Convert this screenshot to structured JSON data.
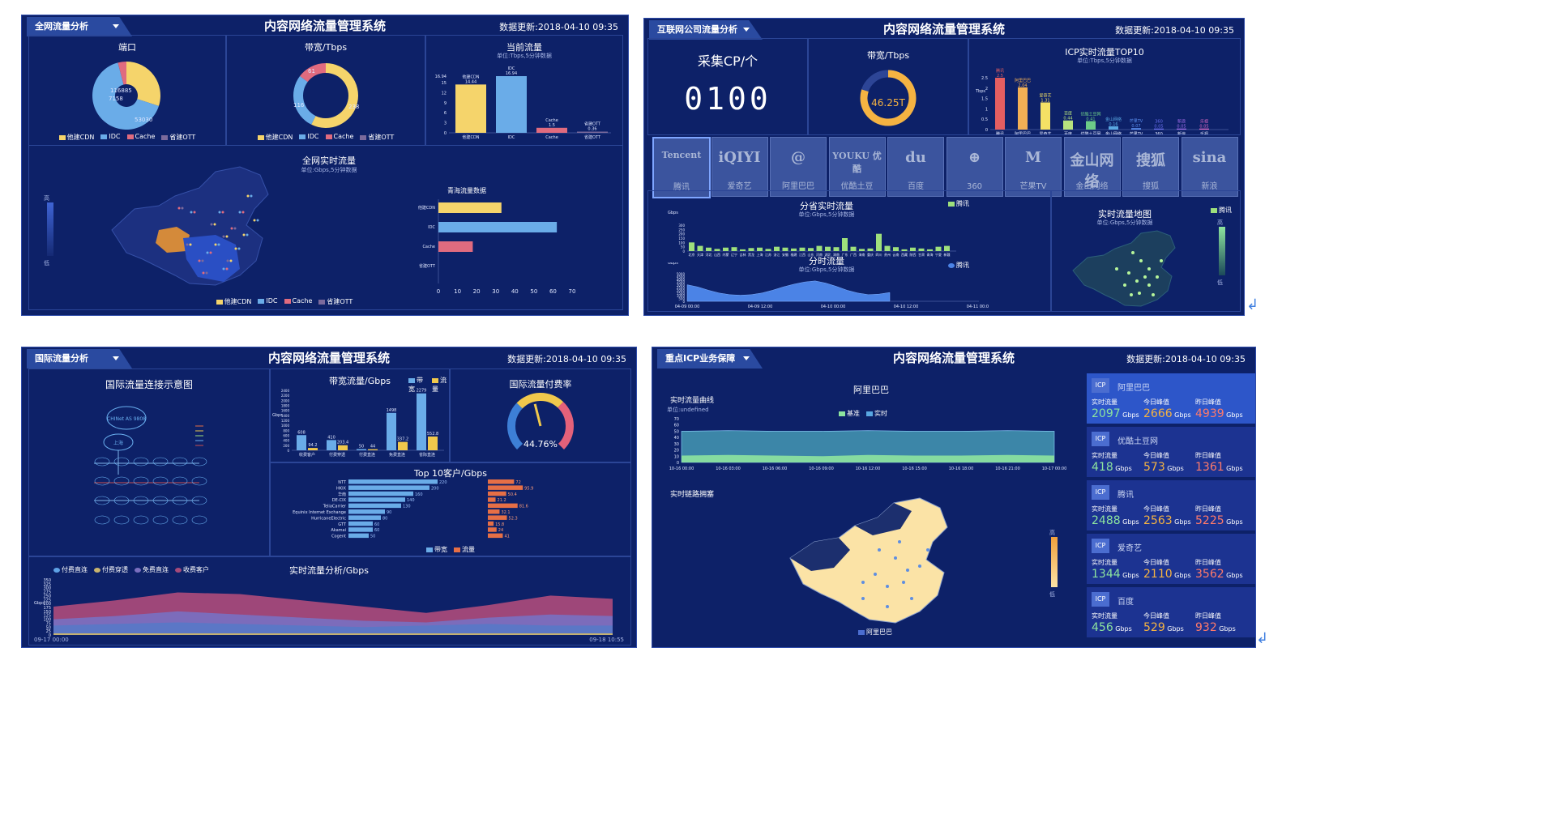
{
  "system_title": "内容网络流量管理系统",
  "update_time": "数据更新:2018-04-10 09:35",
  "panels": {
    "p1": {
      "tab": "全网流量分析",
      "port": {
        "title": "端口",
        "labels": [
          "116885",
          "7158",
          "53030"
        ]
      },
      "bandwidth": {
        "title": "带宽/Tbps",
        "labels": [
          "61",
          "116",
          "238"
        ]
      },
      "current": {
        "title": "当前流量",
        "subtitle": "单位:Tbps,5分钟数据"
      },
      "legend": [
        {
          "name": "他建CDN",
          "color": "#f5d46b"
        },
        {
          "name": "IDC",
          "color": "#6aace8"
        },
        {
          "name": "Cache",
          "color": "#e06b7f"
        },
        {
          "name": "省建OTT",
          "color": "#7b6a9c"
        }
      ],
      "map": {
        "title": "全网实时流量",
        "subtitle": "单位:Gbps,5分钟数据",
        "high": "高",
        "low": "低"
      },
      "province": {
        "title": "青海流量数据"
      }
    },
    "p2": {
      "tab": "互联网公司流量分析",
      "cp": {
        "title": "采集CP/个",
        "value": "0100"
      },
      "bw": {
        "title": "带宽/Tbps",
        "value": "46.25T"
      },
      "top10": {
        "title": "ICP实时流量TOP10",
        "subtitle": "单位:Tbps,5分钟数据"
      },
      "logos": [
        {
          "mark": "Tencent",
          "name": "腾讯"
        },
        {
          "mark": "iQIYI",
          "name": "爱奇艺"
        },
        {
          "mark": "@",
          "name": "阿里巴巴"
        },
        {
          "mark": "YOUKU 优酷",
          "name": "优酷土豆"
        },
        {
          "mark": "du",
          "name": "百度"
        },
        {
          "mark": "⊕",
          "name": "360"
        },
        {
          "mark": "M",
          "name": "芒果TV"
        },
        {
          "mark": "金山网络",
          "name": "金山网络"
        },
        {
          "mark": "搜狐",
          "name": "搜狐"
        },
        {
          "mark": "sina",
          "name": "新浪"
        }
      ],
      "province_rt": {
        "title": "分省实时流量",
        "subtitle": "单位:Gbps,5分钟数据",
        "unit": "Gbps",
        "legend": "腾讯"
      },
      "time_flow": {
        "title": "分时流量",
        "subtitle": "单位:Gbps,5分钟数据",
        "unit": "Gbps",
        "legend": "腾讯"
      },
      "map": {
        "title": "实时流量地图",
        "subtitle": "单位:Gbps,5分钟数据",
        "legend": "腾讯",
        "high": "高",
        "low": "低"
      }
    },
    "p3": {
      "tab": "国际流量分析",
      "connect": {
        "title": "国际流量连接示意图",
        "cloud1": "CHINet AS 9808",
        "cloud2": "上海"
      },
      "bw_flow": {
        "title": "带宽流量/Gbps",
        "legend": [
          "带宽",
          "流量"
        ]
      },
      "rate": {
        "title": "国际流量付费率",
        "value": "44.76%"
      },
      "top10": {
        "title": "Top 10客户/Gbps",
        "legend": [
          "带宽",
          "流量"
        ]
      },
      "rt": {
        "title": "实时流量分析/Gbps",
        "legend": [
          "付费直连",
          "付费穿透",
          "免费直连",
          "收费客户"
        ],
        "x_start": "09-17 00:00",
        "x_end": "09-18 10:55",
        "ylabel": "Gbps"
      }
    },
    "p4": {
      "tab": "重点ICP业务保障",
      "company": "阿里巴巴",
      "curve": {
        "title": "实时流量曲线",
        "subtitle": "单位:undefined",
        "legend": [
          "基准",
          "实时"
        ]
      },
      "link": {
        "title": "实时链路拥塞"
      },
      "map_legend": "阿里巴巴",
      "map_high": "高",
      "map_low": "低",
      "col_labels": [
        "实时流量",
        "今日峰值",
        "昨日峰值"
      ],
      "unit": "Gbps",
      "icps": [
        {
          "badge": "ICP",
          "name": "阿里巴巴",
          "v": [
            "2097",
            "2666",
            "4939"
          ]
        },
        {
          "badge": "ICP",
          "name": "优酷土豆网",
          "v": [
            "418",
            "573",
            "1361"
          ]
        },
        {
          "badge": "ICP",
          "name": "腾讯",
          "v": [
            "2488",
            "2563",
            "5225"
          ]
        },
        {
          "badge": "ICP",
          "name": "爱奇艺",
          "v": [
            "1344",
            "2110",
            "3562"
          ]
        },
        {
          "badge": "ICP",
          "name": "百度",
          "v": [
            "456",
            "529",
            "932"
          ]
        }
      ]
    }
  },
  "chart_data": [
    {
      "type": "pie",
      "title": "端口",
      "categories": [
        "他建CDN",
        "IDC",
        "Cache",
        "省建OTT"
      ],
      "values": [
        53030,
        116885,
        7158,
        0
      ]
    },
    {
      "type": "pie",
      "title": "带宽/Tbps",
      "categories": [
        "他建CDN",
        "IDC",
        "Cache",
        "省建OTT"
      ],
      "values": [
        238,
        116,
        61,
        0
      ]
    },
    {
      "type": "bar",
      "title": "当前流量",
      "categories": [
        "他建CDN",
        "IDC",
        "Cache",
        "省建OTT"
      ],
      "values": [
        14.44,
        16.94,
        1.5,
        0.36
      ],
      "yticks": [
        0,
        3,
        6,
        9,
        12,
        15,
        16.94
      ],
      "ylim": [
        0,
        16.94
      ]
    },
    {
      "type": "bar",
      "title": "青海流量数据",
      "categories": [
        "他建CDN",
        "IDC",
        "Cache",
        "省建OTT"
      ],
      "values": [
        33,
        62,
        18,
        0
      ],
      "xlim": [
        0,
        70
      ],
      "xticks": [
        0,
        10,
        20,
        30,
        40,
        50,
        60,
        70
      ]
    },
    {
      "type": "bar",
      "title": "ICP实时流量TOP10",
      "categories": [
        "腾讯",
        "阿里巴巴",
        "爱奇艺",
        "百度",
        "优酷土豆网",
        "金山网络",
        "芒果TV",
        "360",
        "新浪",
        "乐视"
      ],
      "values": [
        2.5,
        2.04,
        1.31,
        0.44,
        0.41,
        0.16,
        0.07,
        0.05,
        0.05,
        0.05
      ],
      "ylabel": "Tbps",
      "yticks": [
        0,
        0.5,
        1,
        1.5,
        2,
        2.5
      ],
      "ylim": [
        0,
        2.5
      ],
      "colors": [
        "#e45e61",
        "#f2b055",
        "#f5e165",
        "#b7e27e",
        "#6ccb88",
        "#59a7e2",
        "#5b8ff0",
        "#6a6ff0",
        "#a06ce8",
        "#e069c4"
      ]
    },
    {
      "type": "bar",
      "title": "分省实时流量",
      "categories": [
        "北京",
        "天津",
        "河北",
        "山西",
        "内蒙古",
        "辽宁",
        "吉林",
        "黑龙江",
        "上海",
        "江苏",
        "浙江",
        "安徽",
        "福建",
        "江西",
        "山东",
        "河南",
        "湖北",
        "湖南",
        "广东",
        "广西",
        "海南",
        "重庆",
        "四川",
        "贵州",
        "云南",
        "西藏",
        "陕西",
        "甘肃",
        "青海",
        "宁夏",
        "新疆"
      ],
      "values": [
        100,
        60,
        40,
        25,
        40,
        45,
        20,
        35,
        40,
        25,
        50,
        40,
        30,
        40,
        35,
        60,
        50,
        45,
        150,
        50,
        25,
        30,
        200,
        60,
        45,
        20,
        40,
        30,
        20,
        50,
        60
      ],
      "ylim": [
        0,
        300
      ],
      "yticks": [
        0,
        50,
        100,
        150,
        200,
        250,
        300
      ],
      "series_name": "腾讯"
    },
    {
      "type": "area",
      "title": "分时流量",
      "x": [
        "04-09 00:00",
        "04-09 12:00",
        "04-10 00:00",
        "04-10 12:00",
        "04-11 00:00"
      ],
      "yticks": [
        0,
        500,
        1000,
        1500,
        2000,
        2500,
        3000,
        3500,
        4000,
        4500,
        5000
      ],
      "ylim": [
        0,
        5000
      ],
      "values": [
        3000,
        2600,
        2000,
        1500,
        1200,
        1100,
        1200,
        1500,
        2000,
        2600,
        3100,
        3500,
        3700,
        3300,
        2700,
        2000,
        1500,
        1200,
        1300,
        1600
      ],
      "series_name": "腾讯"
    },
    {
      "type": "bar",
      "title": "带宽流量/Gbps",
      "categories": [
        "收费客户",
        "付费穿透",
        "付费直连",
        "免费直连",
        "省际直连"
      ],
      "series": [
        {
          "name": "带宽",
          "values": [
            608,
            410,
            50,
            1498,
            2279
          ]
        },
        {
          "name": "流量",
          "values": [
            94.2,
            203.4,
            44,
            337.2,
            552.8
          ]
        }
      ],
      "ylim": [
        0,
        2400
      ],
      "yticks": [
        0,
        200,
        400,
        600,
        800,
        1000,
        1200,
        1400,
        1600,
        1800,
        2000,
        2200,
        2400
      ],
      "ylabel": "Gbps"
    },
    {
      "type": "bar",
      "title": "Top 10客户/Gbps",
      "categories": [
        "NTT",
        "HKIX",
        "华南",
        "DE-CIX",
        "TeliaCarrier",
        "Equinix Internet Exchange",
        "HurricaneElectric",
        "GTT",
        "Akamai",
        "Cogent"
      ],
      "series": [
        {
          "name": "带宽",
          "values": [
            220,
            200,
            160,
            140,
            130,
            90,
            80,
            60,
            60,
            50
          ]
        },
        {
          "name": "流量",
          "values": [
            72,
            95.9,
            50.4,
            21.2,
            81.6,
            32.1,
            52.3,
            15.8,
            24,
            41
          ]
        }
      ]
    },
    {
      "type": "area",
      "title": "实时流量分析/Gbps",
      "x": [
        "09-17 00:00",
        "09-18 10:55"
      ],
      "ylim": [
        0,
        350
      ],
      "yticks": [
        0,
        25,
        50,
        75,
        100,
        125,
        150,
        175,
        200,
        225,
        250,
        275,
        300,
        325,
        350
      ],
      "series": [
        {
          "name": "付费直连",
          "values": [
            10,
            10,
            10,
            10,
            10,
            10,
            10,
            10,
            10,
            10
          ]
        },
        {
          "name": "付费穿透",
          "values": [
            60,
            70,
            80,
            70,
            60,
            50,
            60,
            70,
            60,
            60
          ]
        },
        {
          "name": "免费直连",
          "values": [
            100,
            120,
            150,
            130,
            110,
            90,
            80,
            110,
            130,
            120
          ]
        },
        {
          "name": "收费客户",
          "values": [
            180,
            220,
            270,
            260,
            220,
            180,
            140,
            190,
            250,
            230
          ]
        }
      ]
    },
    {
      "type": "area",
      "title": "实时流量曲线",
      "x": [
        "10-16 00:00",
        "10-16 03:00",
        "10-16 06:00",
        "10-16 09:00",
        "10-16 12:00",
        "10-16 15:00",
        "10-16 18:00",
        "10-16 21:00",
        "10-17 00:00"
      ],
      "ylim": [
        0,
        70
      ],
      "yticks": [
        0,
        10,
        20,
        30,
        40,
        50,
        60,
        70
      ],
      "series": [
        {
          "name": "基准",
          "values": [
            50,
            51,
            50,
            50,
            51,
            50,
            50,
            51,
            50
          ]
        },
        {
          "name": "实时",
          "values": [
            11,
            12,
            11,
            10,
            12,
            11,
            11,
            12,
            11
          ]
        }
      ]
    },
    {
      "type": "pie",
      "title": "国际流量付费率",
      "values": [
        44.76
      ]
    },
    {
      "type": "pie",
      "title": "带宽/Tbps",
      "values": [
        46.25
      ]
    }
  ]
}
